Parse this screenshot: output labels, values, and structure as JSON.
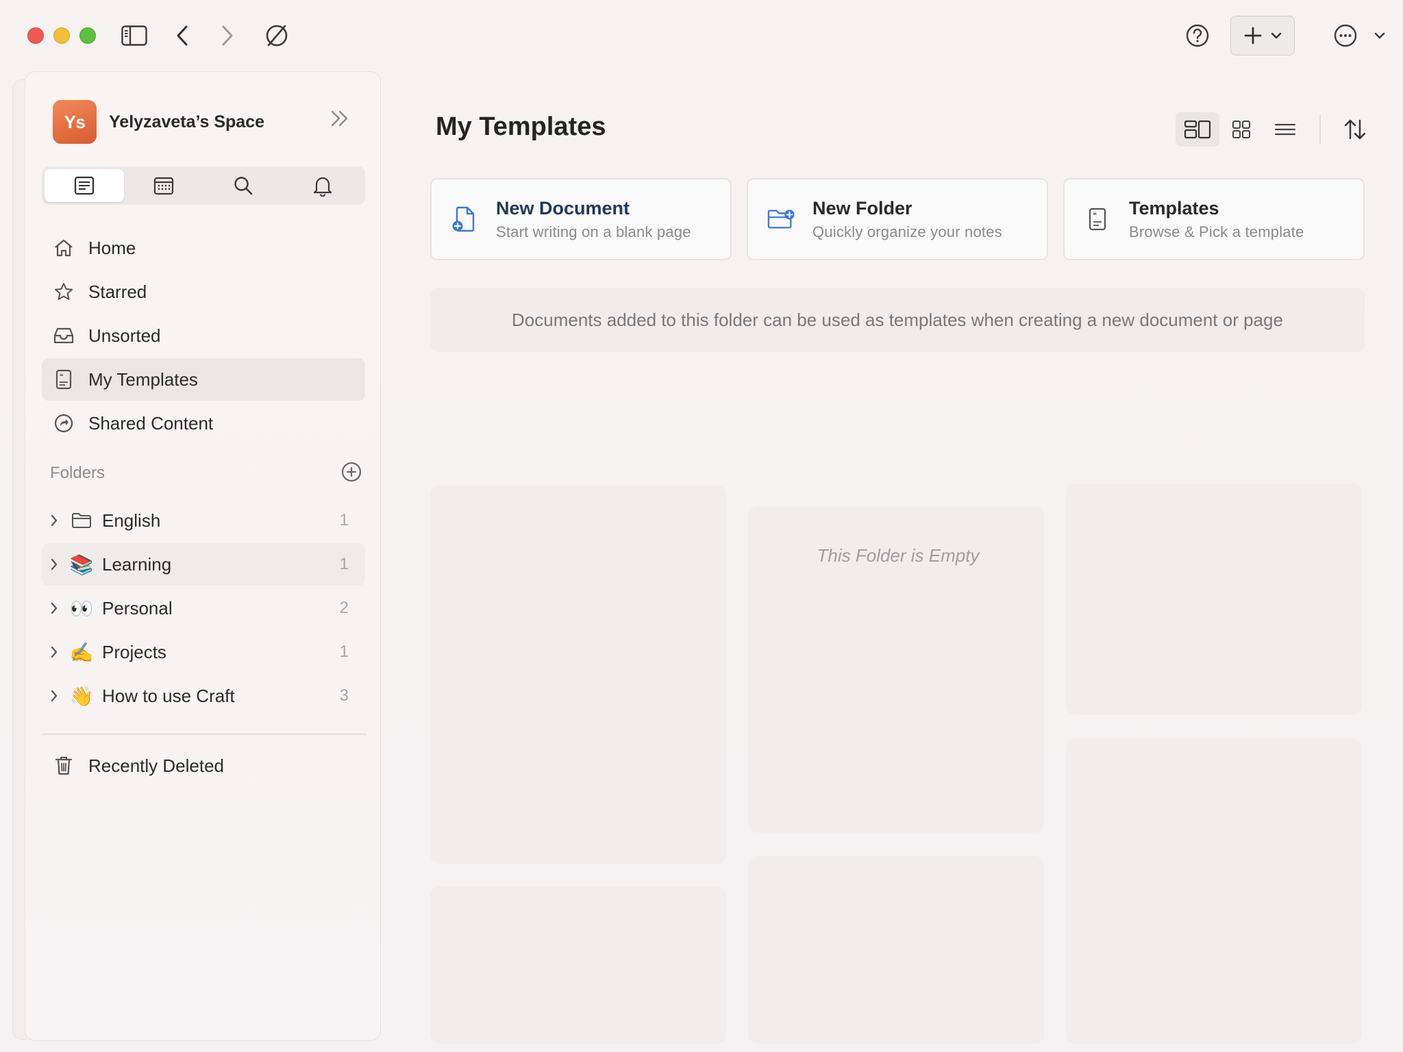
{
  "space": {
    "initials": "Ys",
    "name": "Yelyzaveta’s Space"
  },
  "nav": [
    {
      "label": "Home",
      "icon": "home-icon"
    },
    {
      "label": "Starred",
      "icon": "star-icon"
    },
    {
      "label": "Unsorted",
      "icon": "inbox-icon"
    },
    {
      "label": "My Templates",
      "icon": "template-icon",
      "selected": true
    },
    {
      "label": "Shared Content",
      "icon": "share-icon"
    }
  ],
  "folders": {
    "title": "Folders",
    "items": [
      {
        "name": "English",
        "icon": "folder-icon",
        "count": "1"
      },
      {
        "name": "Learning",
        "emoji": "📚",
        "count": "1"
      },
      {
        "name": "Personal",
        "emoji": "👀",
        "count": "2"
      },
      {
        "name": "Projects",
        "emoji": "✍️",
        "count": "1"
      },
      {
        "name": "How to use Craft",
        "emoji": "👋",
        "count": "3"
      }
    ]
  },
  "recently_deleted": "Recently Deleted",
  "main": {
    "title": "My Templates",
    "cards": [
      {
        "title": "New Document",
        "subtitle": "Start writing on a blank page"
      },
      {
        "title": "New Folder",
        "subtitle": "Quickly organize your notes"
      },
      {
        "title": "Templates",
        "subtitle": "Browse & Pick a template"
      }
    ],
    "info": "Documents added to this folder can be used as templates when creating a new document or page",
    "empty": "This Folder is Empty"
  },
  "colors": {
    "accent": "#3a78d8",
    "avatar": "#e56f3e",
    "selected_bg": "#ebe6e5"
  }
}
